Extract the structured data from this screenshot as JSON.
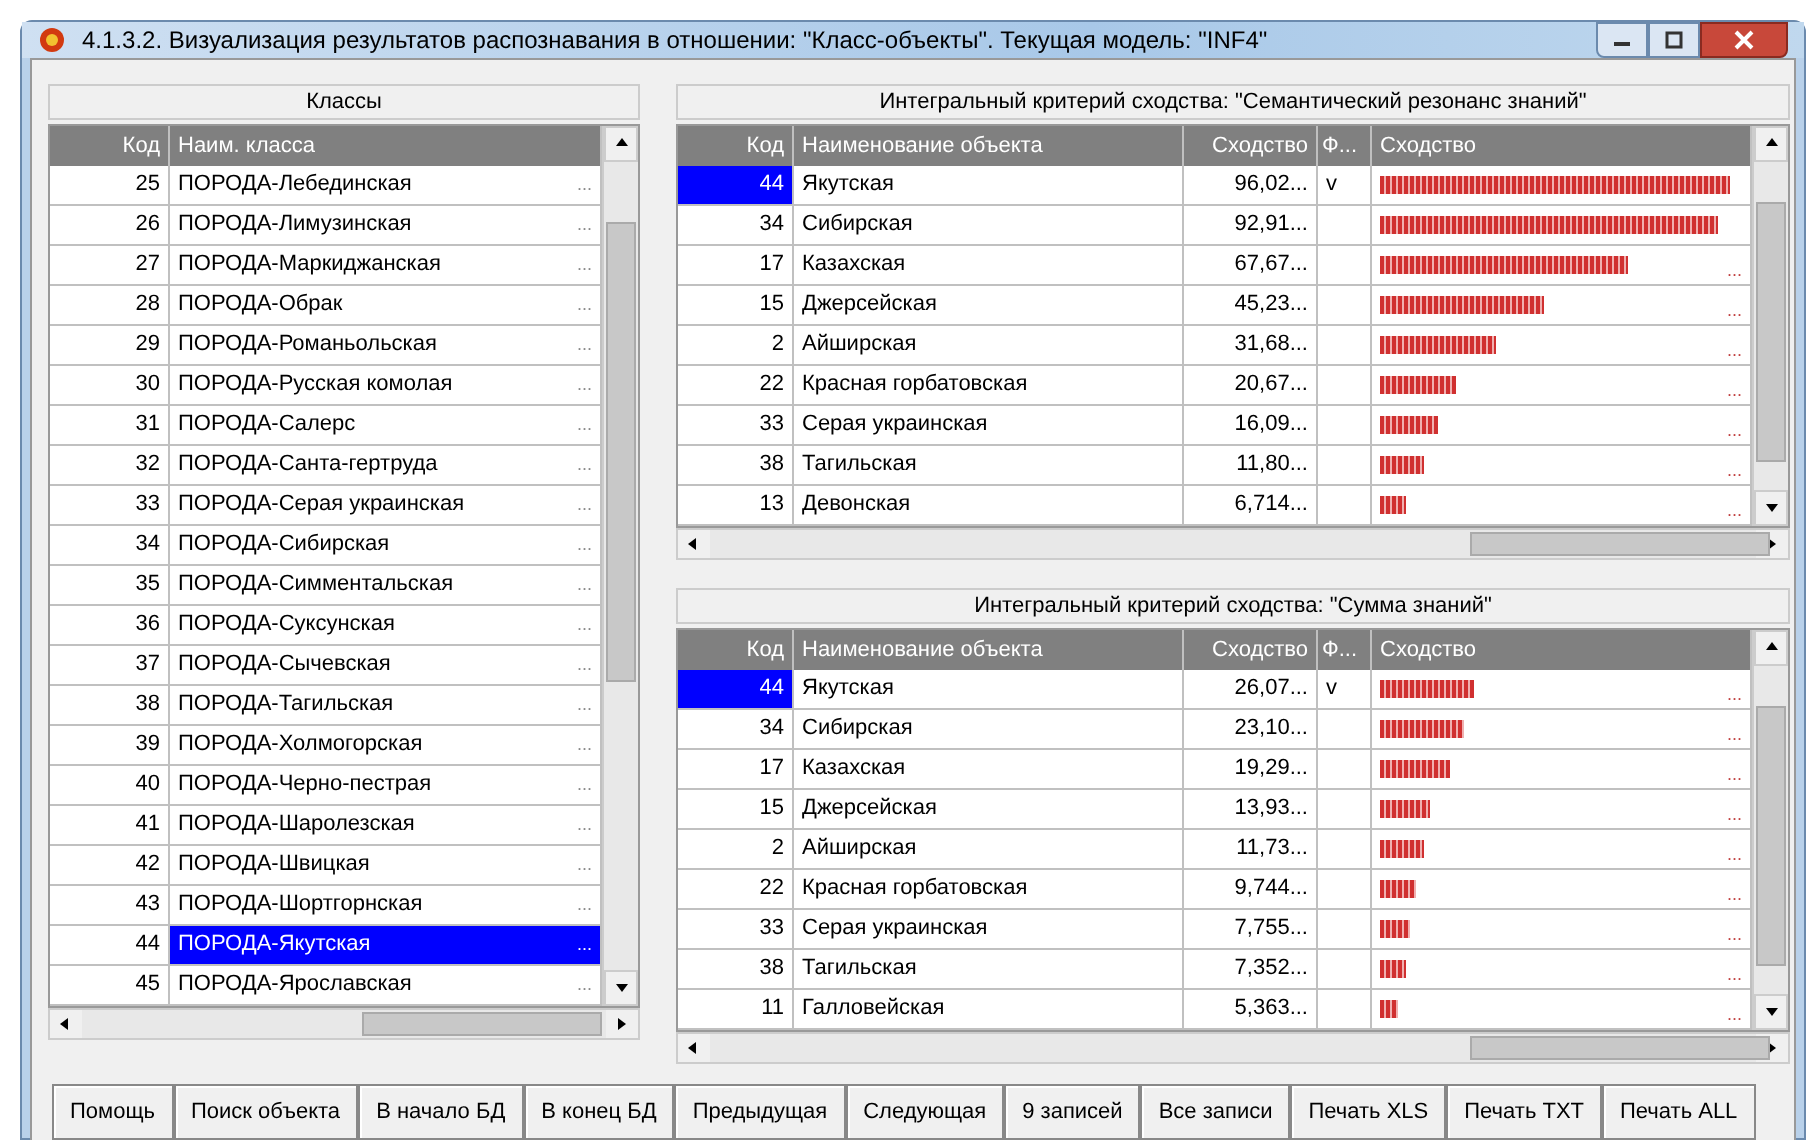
{
  "window": {
    "title": "4.1.3.2. Визуализация результатов распознавания в отношении: \"Класс-объекты\". Текущая модель: \"INF4\""
  },
  "classes_panel": {
    "title": "Классы",
    "columns": [
      "Код",
      "Наим. класса"
    ],
    "rows": [
      {
        "code": "25",
        "name": "ПОРОДА-Лебединская",
        "more": "...",
        "selected": false
      },
      {
        "code": "26",
        "name": "ПОРОДА-Лимузинская",
        "more": "...",
        "selected": false
      },
      {
        "code": "27",
        "name": "ПОРОДА-Маркиджанская",
        "more": "...",
        "selected": false
      },
      {
        "code": "28",
        "name": "ПОРОДА-Обрак",
        "more": "...",
        "selected": false
      },
      {
        "code": "29",
        "name": "ПОРОДА-Романьольская",
        "more": "...",
        "selected": false
      },
      {
        "code": "30",
        "name": "ПОРОДА-Русская комолая",
        "more": "...",
        "selected": false
      },
      {
        "code": "31",
        "name": "ПОРОДА-Салерс",
        "more": "...",
        "selected": false
      },
      {
        "code": "32",
        "name": "ПОРОДА-Санта-гертруда",
        "more": "...",
        "selected": false
      },
      {
        "code": "33",
        "name": "ПОРОДА-Серая украинская",
        "more": "...",
        "selected": false
      },
      {
        "code": "34",
        "name": "ПОРОДА-Сибирская",
        "more": "...",
        "selected": false
      },
      {
        "code": "35",
        "name": "ПОРОДА-Симментальская",
        "more": "...",
        "selected": false
      },
      {
        "code": "36",
        "name": "ПОРОДА-Суксунская",
        "more": "...",
        "selected": false
      },
      {
        "code": "37",
        "name": "ПОРОДА-Сычевская",
        "more": "...",
        "selected": false
      },
      {
        "code": "38",
        "name": "ПОРОДА-Тагильская",
        "more": "...",
        "selected": false
      },
      {
        "code": "39",
        "name": "ПОРОДА-Холмогорская",
        "more": "...",
        "selected": false
      },
      {
        "code": "40",
        "name": "ПОРОДА-Черно-пестрая",
        "more": "...",
        "selected": false
      },
      {
        "code": "41",
        "name": "ПОРОДА-Шаролезская",
        "more": "...",
        "selected": false
      },
      {
        "code": "42",
        "name": "ПОРОДА-Швицкая",
        "more": "...",
        "selected": false
      },
      {
        "code": "43",
        "name": "ПОРОДА-Шортгорнская",
        "more": "...",
        "selected": false
      },
      {
        "code": "44",
        "name": "ПОРОДА-Якутская",
        "more": "...",
        "selected": true
      },
      {
        "code": "45",
        "name": "ПОРОДА-Ярославская",
        "more": "...",
        "selected": false
      }
    ]
  },
  "similarity_panels": [
    {
      "title": "Интегральный критерий сходства: \"Семантический резонанс знаний\"",
      "columns": [
        "Код",
        "Наименование объекта",
        "Сходство",
        "Ф...",
        "Сходство"
      ],
      "rows": [
        {
          "code": "44",
          "name": "Якутская",
          "value": "96,02...",
          "flag": "v",
          "level": 0.96,
          "selected": true
        },
        {
          "code": "34",
          "name": "Сибирская",
          "value": "92,91...",
          "level": 0.93,
          "selected": false
        },
        {
          "code": "17",
          "name": "Казахская",
          "value": "67,67...",
          "level": 0.68,
          "more": "...",
          "selected": false
        },
        {
          "code": "15",
          "name": "Джерсейская",
          "value": "45,23...",
          "level": 0.45,
          "more": "...",
          "selected": false
        },
        {
          "code": "2",
          "name": "Айширская",
          "value": "31,68...",
          "level": 0.32,
          "more": "...",
          "selected": false
        },
        {
          "code": "22",
          "name": "Красная горбатовская",
          "value": "20,67...",
          "level": 0.21,
          "more": "...",
          "selected": false
        },
        {
          "code": "33",
          "name": "Серая украинская",
          "value": "16,09...",
          "level": 0.16,
          "more": "...",
          "selected": false
        },
        {
          "code": "38",
          "name": "Тагильская",
          "value": "11,80...",
          "level": 0.12,
          "more": "...",
          "selected": false
        },
        {
          "code": "13",
          "name": "Девонская",
          "value": "6,714...",
          "level": 0.07,
          "more": "...",
          "selected": false
        }
      ]
    },
    {
      "title": "Интегральный критерий сходства: \"Сумма знаний\"",
      "columns": [
        "Код",
        "Наименование объекта",
        "Сходство",
        "Ф...",
        "Сходство"
      ],
      "rows": [
        {
          "code": "44",
          "name": "Якутская",
          "value": "26,07...",
          "flag": "v",
          "level": 0.26,
          "more": "...",
          "selected": true
        },
        {
          "code": "34",
          "name": "Сибирская",
          "value": "23,10...",
          "level": 0.23,
          "more": "...",
          "selected": false
        },
        {
          "code": "17",
          "name": "Казахская",
          "value": "19,29...",
          "level": 0.19,
          "more": "...",
          "selected": false
        },
        {
          "code": "15",
          "name": "Джерсейская",
          "value": "13,93...",
          "level": 0.14,
          "more": "...",
          "selected": false
        },
        {
          "code": "2",
          "name": "Айширская",
          "value": "11,73...",
          "level": 0.12,
          "more": "...",
          "selected": false
        },
        {
          "code": "22",
          "name": "Красная горбатовская",
          "value": "9,744...",
          "level": 0.1,
          "more": "...",
          "selected": false
        },
        {
          "code": "33",
          "name": "Серая украинская",
          "value": "7,755...",
          "level": 0.08,
          "more": "...",
          "selected": false
        },
        {
          "code": "38",
          "name": "Тагильская",
          "value": "7,352...",
          "level": 0.07,
          "more": "...",
          "selected": false
        },
        {
          "code": "11",
          "name": "Галловейская",
          "value": "5,363...",
          "level": 0.05,
          "more": "...",
          "selected": false
        }
      ]
    }
  ],
  "buttons": [
    "Помощь",
    "Поиск объекта",
    "В начало БД",
    "В конец БД",
    "Предыдущая",
    "Следующая",
    "9 записей",
    "Все записи",
    "Печать XLS",
    "Печать TXT",
    "Печать ALL"
  ]
}
